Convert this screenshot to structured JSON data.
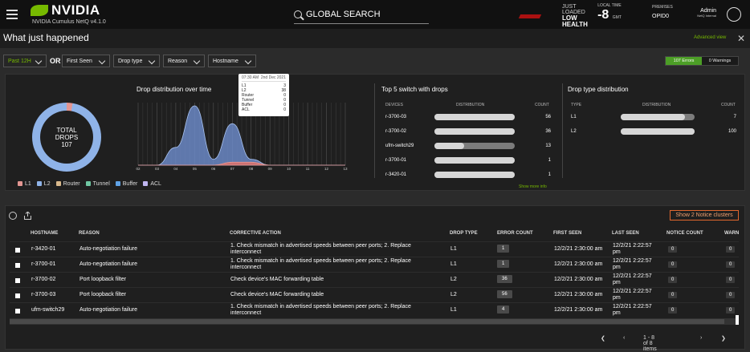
{
  "app": {
    "brand": "NVIDIA",
    "subtitle": "NVIDIA Cumulus NetQ v4.1.0",
    "search_placeholder": "GLOBAL SEARCH",
    "health_line1": "JUST",
    "health_line2": "LOADED",
    "health_line3": "LOW",
    "health_line4": "HEALTH",
    "local_time_label": "LOCAL TIME",
    "local_time_value": "-8",
    "local_time_unit": "GMT",
    "premises_label": "PREMISES",
    "premises_value": "OPID0",
    "user_name": "Admin",
    "user_org": "NetQ Internal"
  },
  "page": {
    "title": "What just happened",
    "advanced_view": "Advanced view"
  },
  "filters": {
    "time": "Past 12H",
    "or": "OR",
    "first_seen": "First Seen",
    "drop_type": "Drop type",
    "reason": "Reason",
    "hostname": "Hostname",
    "errors_tab": "107 Errors",
    "warnings_tab": "0 Warnings"
  },
  "summary": {
    "total_label1": "TOTAL",
    "total_label2": "DROPS",
    "total_value": "107",
    "legend": [
      "L1",
      "L2",
      "Router",
      "Tunnel",
      "Buffer",
      "ACL"
    ],
    "legend_colors": [
      "#e39692",
      "#8fb3e8",
      "#d9b98c",
      "#6fc6a2",
      "#5fa2e6",
      "#c0b6f0"
    ],
    "donut": {
      "L1": 7,
      "L2": 100
    }
  },
  "chart_data": [
    {
      "type": "area",
      "title": "Drop distribution over time",
      "x": [
        "02",
        "03",
        "04",
        "05",
        "06",
        "07",
        "08",
        "09",
        "10",
        "11",
        "12",
        "13"
      ],
      "series": [
        {
          "name": "L2",
          "values": [
            0,
            0,
            6,
            20,
            2,
            14,
            2,
            0,
            0,
            0,
            0,
            0
          ]
        },
        {
          "name": "L1",
          "values": [
            0,
            0,
            0,
            0,
            0,
            1,
            1,
            0,
            0,
            0,
            0,
            0
          ]
        }
      ]
    }
  ],
  "tooltip": {
    "time": "07:30 AM",
    "date": "2nd Dec 2021",
    "rows": [
      {
        "label": "L1",
        "value": "3"
      },
      {
        "label": "L2",
        "value": "38"
      },
      {
        "label": "Router",
        "value": "0"
      },
      {
        "label": "Tunnel",
        "value": "0"
      },
      {
        "label": "Buffer",
        "value": "0"
      },
      {
        "label": "ACL",
        "value": "0"
      }
    ]
  },
  "top_switches": {
    "title": "Top 5 switch with drops",
    "col_devices": "DEVICES",
    "col_distribution": "DISTRIBUTION",
    "col_count": "COUNT",
    "rows": [
      {
        "device": "r-3700-03",
        "count": "56",
        "fraction": 1.0
      },
      {
        "device": "r-3700-02",
        "count": "36",
        "fraction": 1.0
      },
      {
        "device": "ufm-switch29",
        "count": "13",
        "fraction": 0.37
      },
      {
        "device": "r-3700-01",
        "count": "1",
        "fraction": 1.0
      },
      {
        "device": "r-3420-01",
        "count": "1",
        "fraction": 1.0
      }
    ],
    "show_more": "Show more info"
  },
  "drop_types": {
    "title": "Drop type distribution",
    "col_type": "TYPE",
    "col_distribution": "DISTRIBUTION",
    "col_count": "COUNT",
    "rows": [
      {
        "type": "L1",
        "count": "7",
        "fraction": 0.87
      },
      {
        "type": "L2",
        "count": "100",
        "fraction": 1.0
      }
    ]
  },
  "table": {
    "notice_button": "Show 2 Notice clusters",
    "headers": [
      "HOSTNAME",
      "REASON",
      "CORRECTIVE ACTION",
      "DROP TYPE",
      "ERROR COUNT",
      "FIRST SEEN",
      "LAST SEEN",
      "NOTICE COUNT",
      "WARN"
    ],
    "rows": [
      {
        "hostname": "r-3420-01",
        "reason": "Auto-negotiation failure",
        "action1": "1. Check mismatch in advertised speeds between peer ports; 2. Replace",
        "action2": "interconnect",
        "drop_type": "L1",
        "error_count": "1",
        "first_seen": "12/2/21 2:30:00 am",
        "last_seen1": "12/2/21 2:22:57",
        "last_seen2": "pm",
        "notice": "0",
        "warn": "0"
      },
      {
        "hostname": "r-3700-01",
        "reason": "Auto-negotiation failure",
        "action1": "1. Check mismatch in advertised speeds between peer ports; 2. Replace",
        "action2": "interconnect",
        "drop_type": "L1",
        "error_count": "1",
        "first_seen": "12/2/21 2:30:00 am",
        "last_seen1": "12/2/21 2:22:57",
        "last_seen2": "pm",
        "notice": "0",
        "warn": "0"
      },
      {
        "hostname": "r-3700-02",
        "reason": "Port loopback filter",
        "action1": "Check device's MAC forwarding table",
        "action2": "",
        "drop_type": "L2",
        "error_count": "36",
        "first_seen": "12/2/21 2:30:00 am",
        "last_seen1": "12/2/21 2:22:57",
        "last_seen2": "pm",
        "notice": "0",
        "warn": "0"
      },
      {
        "hostname": "r-3700-03",
        "reason": "Port loopback filter",
        "action1": "Check device's MAC forwarding table",
        "action2": "",
        "drop_type": "L2",
        "error_count": "56",
        "first_seen": "12/2/21 2:30:00 am",
        "last_seen1": "12/2/21 2:22:57",
        "last_seen2": "pm",
        "notice": "0",
        "warn": "0"
      },
      {
        "hostname": "ufm-switch29",
        "reason": "Auto-negotiation failure",
        "action1": "1. Check mismatch in advertised speeds between peer ports; 2. Replace",
        "action2": "interconnect",
        "drop_type": "L1",
        "error_count": "4",
        "first_seen": "12/2/21 2:30:00 am",
        "last_seen1": "12/2/21 2:22:57",
        "last_seen2": "pm",
        "notice": "0",
        "warn": "0"
      }
    ],
    "pager_text": "1 - 8 of 8 items"
  }
}
